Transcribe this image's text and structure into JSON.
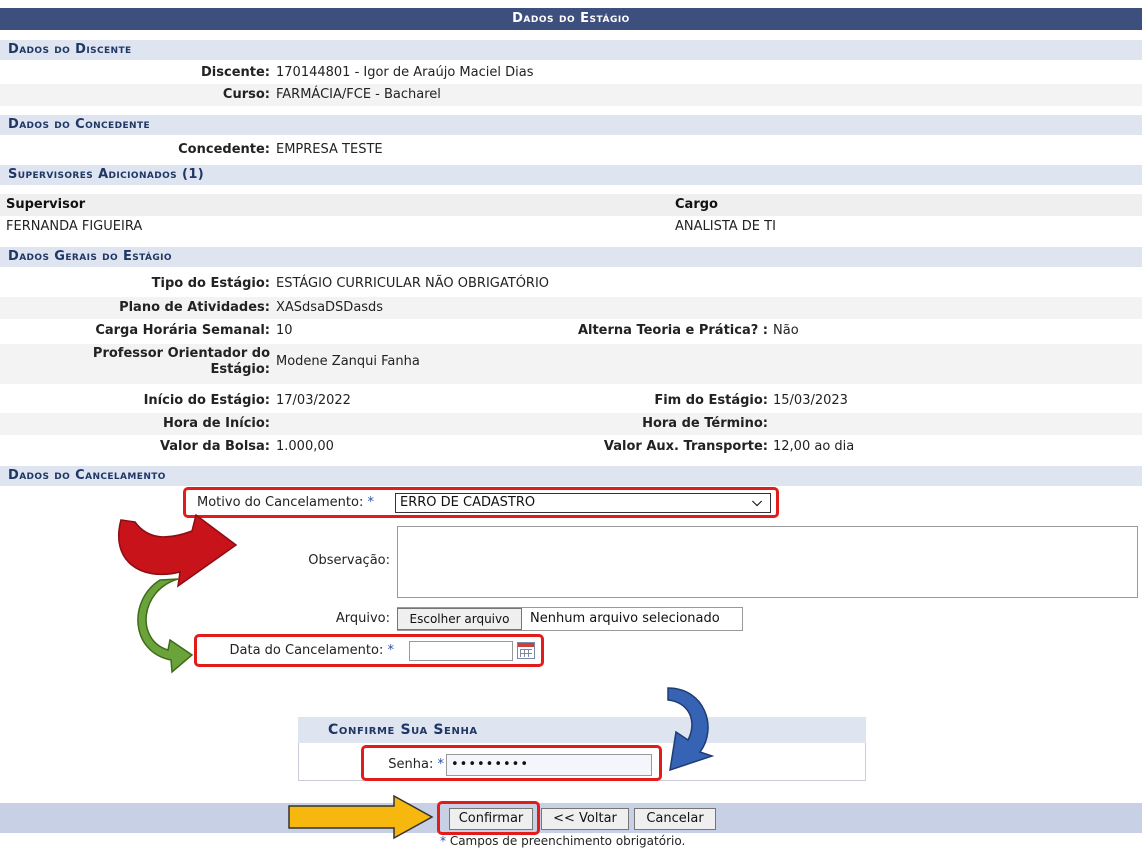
{
  "header": {
    "title": "Dados do Estágio"
  },
  "discente": {
    "section": "Dados do Discente",
    "discente_label": "Discente:",
    "discente_value": "170144801 - Igor de Araújo Maciel Dias",
    "curso_label": "Curso:",
    "curso_value": "FARMÁCIA/FCE - Bacharel"
  },
  "concedente": {
    "section": "Dados do Concedente",
    "label": "Concedente:",
    "value": "EMPRESA TESTE"
  },
  "supervisores": {
    "section": "Supervisores Adicionados (1)",
    "col_supervisor": "Supervisor",
    "col_cargo": "Cargo",
    "rows": [
      {
        "supervisor": "FERNANDA FIGUEIRA",
        "cargo": "ANALISTA DE TI"
      }
    ]
  },
  "gerais": {
    "section": "Dados Gerais do Estágio",
    "tipo_label": "Tipo do Estágio:",
    "tipo_value": "ESTÁGIO CURRICULAR NÃO OBRIGATÓRIO",
    "plano_label": "Plano de Atividades:",
    "plano_value": "XASdsaDSDasds",
    "carga_label": "Carga Horária Semanal:",
    "carga_value": "10",
    "alterna_label": "Alterna Teoria e Prática? :",
    "alterna_value": "Não",
    "prof_label_1": "Professor Orientador do",
    "prof_label_2": "Estágio:",
    "prof_value": "Modene Zanqui Fanha",
    "inicio_label": "Início do Estágio:",
    "inicio_value": "17/03/2022",
    "fim_label": "Fim do Estágio:",
    "fim_value": "15/03/2023",
    "hora_inicio_label": "Hora de Início:",
    "hora_termino_label": "Hora de Término:",
    "bolsa_label": "Valor da Bolsa:",
    "bolsa_value": "1.000,00",
    "transporte_label": "Valor Aux. Transporte:",
    "transporte_value": "12,00 ao dia"
  },
  "cancelamento": {
    "section": "Dados do Cancelamento",
    "motivo_label": "Motivo do Cancelamento:",
    "motivo_value": "ERRO DE CADASTRO",
    "observacao_label": "Observação:",
    "arquivo_label": "Arquivo:",
    "arquivo_button": "Escolher arquivo",
    "arquivo_status": "Nenhum arquivo selecionado",
    "data_label": "Data do Cancelamento:",
    "data_value": ""
  },
  "senha": {
    "title": "Confirme Sua Senha",
    "label": "Senha:",
    "value": "•••••••••"
  },
  "buttons": {
    "confirmar": "Confirmar",
    "voltar": "<< Voltar",
    "cancelar": "Cancelar"
  },
  "footer_note": "Campos de preenchimento obrigatório.",
  "required_star": "*",
  "colors": {
    "header": "#3d4f7d",
    "section_bg": "#dfe4f1",
    "section_text": "#1f3764",
    "highlight": "#e21b1b",
    "arrow_red": "#c8131a",
    "arrow_green": "#6aa339",
    "arrow_blue": "#3663b3",
    "arrow_yellow": "#f6b80f"
  }
}
